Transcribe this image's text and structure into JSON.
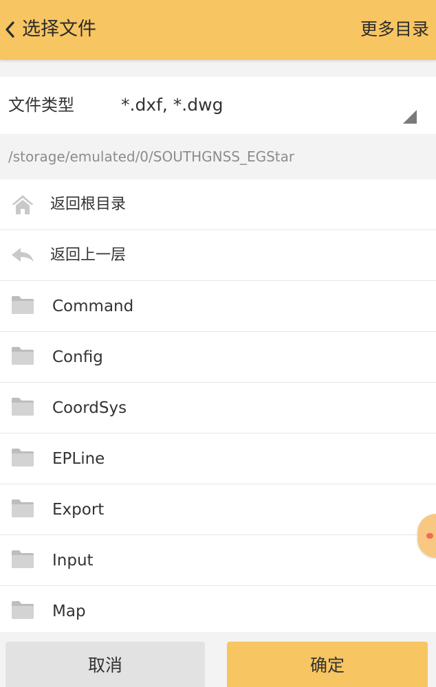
{
  "header": {
    "title": "选择文件",
    "more_label": "更多目录"
  },
  "filter": {
    "label": "文件类型",
    "value": "*.dxf, *.dwg"
  },
  "path": "/storage/emulated/0/SOUTHGNSS_EGStar",
  "nav": {
    "root_label": "返回根目录",
    "up_label": "返回上一层"
  },
  "folders": [
    {
      "name": "Command"
    },
    {
      "name": "Config"
    },
    {
      "name": "CoordSys"
    },
    {
      "name": "EPLine"
    },
    {
      "name": "Export"
    },
    {
      "name": "Input"
    },
    {
      "name": "Map"
    }
  ],
  "buttons": {
    "cancel": "取消",
    "ok": "确定"
  },
  "icons": {
    "back": "chevron-left-icon",
    "home": "home-icon",
    "up": "reply-arrow-icon",
    "folder": "folder-icon",
    "dropdown": "dropdown-triangle-icon"
  },
  "colors": {
    "accent": "#f7c561",
    "background": "#f3f3f3",
    "cancel_button": "#e2e2e2",
    "path_text": "#8c8c8c",
    "icon_gray": "#c9c9c9"
  }
}
